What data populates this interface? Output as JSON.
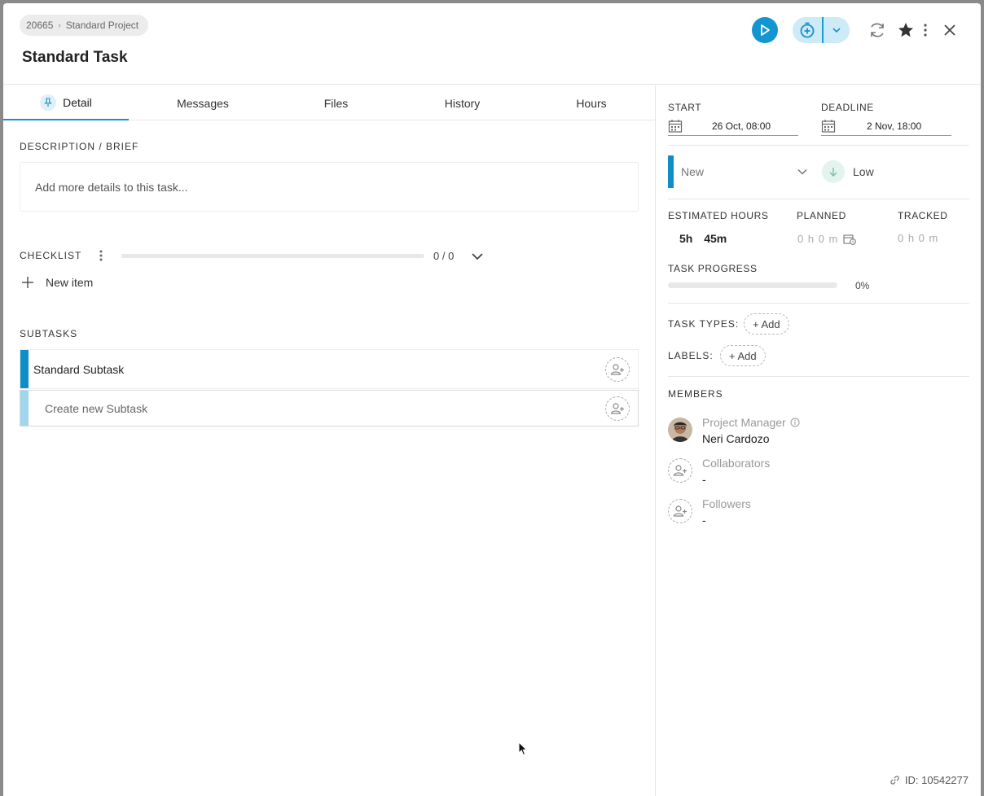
{
  "header": {
    "breadcrumb": {
      "project_id": "20665",
      "project_name": "Standard Project"
    },
    "task_title": "Standard Task"
  },
  "tabs": [
    {
      "label": "Detail",
      "active": true
    },
    {
      "label": "Messages"
    },
    {
      "label": "Files"
    },
    {
      "label": "History"
    },
    {
      "label": "Hours"
    }
  ],
  "description": {
    "label": "DESCRIPTION / BRIEF",
    "placeholder": "Add more details to this task..."
  },
  "checklist": {
    "label": "CHECKLIST",
    "count": "0 / 0",
    "new_item_label": "New item"
  },
  "subtasks": {
    "label": "SUBTASKS",
    "items": [
      {
        "title": "Standard Subtask",
        "color": "#0e8ec7"
      }
    ],
    "create_placeholder": "Create new Subtask",
    "create_color": "#9fd6ec"
  },
  "schedule": {
    "start_label": "START",
    "start_value": "26 Oct, 08:00",
    "deadline_label": "DEADLINE",
    "deadline_value": "2 Nov, 18:00"
  },
  "status": {
    "value": "New",
    "color": "#0e8ec7"
  },
  "priority": {
    "value": "Low"
  },
  "hours": {
    "estimated_label": "ESTIMATED HOURS",
    "estimated_h": "5h",
    "estimated_m": "45m",
    "planned_label": "PLANNED",
    "planned_value": "0 h 0 m",
    "tracked_label": "TRACKED",
    "tracked_value": "0 h 0 m"
  },
  "progress": {
    "label": "TASK PROGRESS",
    "value_text": "0%",
    "fraction": 0
  },
  "task_types": {
    "label": "TASK TYPES:",
    "add_label": "+ Add"
  },
  "labels": {
    "label": "LABELS:",
    "add_label": "+ Add"
  },
  "members": {
    "label": "MEMBERS",
    "project_manager": {
      "role": "Project Manager",
      "name": "Neri Cardozo"
    },
    "collaborators": {
      "role": "Collaborators",
      "value": "-"
    },
    "followers": {
      "role": "Followers",
      "value": "-"
    }
  },
  "footer": {
    "id_text": "ID: 10542277"
  },
  "colors": {
    "accent": "#1296d2",
    "timer_bg": "#cdeaf7"
  }
}
